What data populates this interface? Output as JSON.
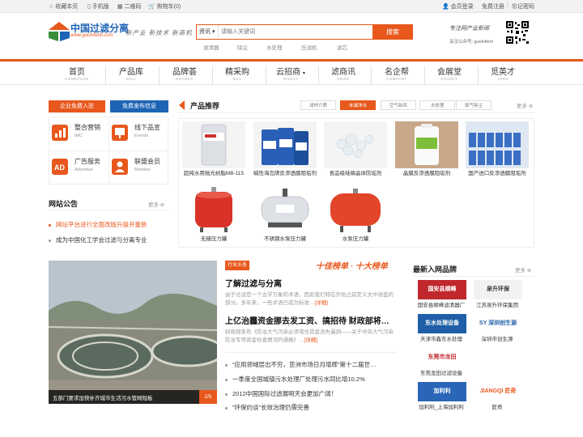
{
  "topbar": {
    "favorite": "收藏本页",
    "mobile": "手机版",
    "qrcode": "二维码",
    "cart": "购物车(0)",
    "login": "会员登录",
    "register": "免费注册",
    "forgot": "忘记密码"
  },
  "logo": {
    "cn": "中国过滤分离",
    "url": "www.guolvfenli.com",
    "slogan": "新产业 新技术 新商机"
  },
  "search": {
    "category": "资讯",
    "placeholder": "请输入关键词",
    "button": "搜索",
    "hot": [
      "滤清器",
      "除尘",
      "水处理",
      "压滤机",
      "滤芯"
    ]
  },
  "wechat": {
    "slogan": "专注网产业新闻",
    "follow": "关注公众号: guolvfenli"
  },
  "nav": [
    {
      "cn": "首页",
      "en": "HOMEPAGE"
    },
    {
      "cn": "产品库",
      "en": "SELL"
    },
    {
      "cn": "品牌荟",
      "en": "BRANDS"
    },
    {
      "cn": "精采购",
      "en": "BUY"
    },
    {
      "cn": "云招商",
      "en": "INVEST"
    },
    {
      "cn": "滤商讯",
      "en": "NEWS"
    },
    {
      "cn": "名企帮",
      "en": "COMPANY"
    },
    {
      "cn": "会展堂",
      "en": "EXHIBIT"
    },
    {
      "cn": "觅英才",
      "en": "JOBS"
    }
  ],
  "left": {
    "enter_btn": "企业免费入驻",
    "publish_btn": "免费发布信息",
    "services": [
      {
        "t1": "整合营销",
        "t2": "IMC",
        "icon": "chart-icon"
      },
      {
        "t1": "线下品宣",
        "t2": "Events",
        "icon": "board-icon"
      },
      {
        "t1": "广告服务",
        "t2": "Advertise",
        "icon": "ad-icon"
      },
      {
        "t1": "联盟会员",
        "t2": "Member",
        "icon": "member-icon"
      }
    ],
    "notice_title": "网站公告",
    "more": "更多",
    "notices": [
      {
        "text": "网站平台进行全面改版升级并重新",
        "color": "#e8581c"
      },
      {
        "text": "成为中国化工学会过滤与分离专业",
        "color": "#333333"
      }
    ]
  },
  "products": {
    "title": "产品推荐",
    "tabs": [
      "滤材介质",
      "末端净水",
      "空气新风",
      "水处理",
      "废气除尘"
    ],
    "active_tab": 1,
    "more": "更多",
    "items": [
      {
        "name": "超纯水用抛光树脂MB-115",
        "color": "#cfd4dc"
      },
      {
        "name": "碱性海岛牌反渗透膜阻垢剂",
        "color": "#2a5fb8"
      },
      {
        "name": "食品级硅磷晶体防垢剂",
        "color": "#e8eef2"
      },
      {
        "name": "晶膜反渗透膜阻垢剂",
        "color": "#7dbf3a"
      },
      {
        "name": "国产进口反渗透膜阻垢剂",
        "color": "#3a6fc4"
      },
      {
        "name": "无缝压力罐",
        "color": "#d93228"
      },
      {
        "name": "不锈钢水泵压力罐",
        "color": "#c8cdd2"
      },
      {
        "name": "水泵压力罐",
        "color": "#e2452a"
      }
    ]
  },
  "feature": {
    "caption": "五部门要求加快补齐城市生活污水管网短板",
    "page": "2/5",
    "badge": "行业头条",
    "banner": "十佳榜单 · 十大榜单",
    "headline1": "了解过滤与分离",
    "summary1": "由于过滤是一个古学万象的术语，因此我们特在开始之前定义文中涵盖的部分。多年来，一些术语已成为标准…",
    "detail": "[详细]",
    "headline2": "上亿治霾资金挪去发工资、搞招待 财政部将…",
    "summary2": "财政部发布《防治大气污染必须堵住资金流失漏洞——关于中央大气污染防治专项资金检查情况的通报》…",
    "news": [
      "“应用领域层出不穷，亚洲市场日月增辉”第十二届世…",
      "一季度全国城镇污水处理厂处理污水同比增10.2%",
      "2012中国国际过滤展明天会更加广阔！",
      "“环保约谈”长效治理仍需完善"
    ]
  },
  "brands": {
    "title": "最新入网品牌",
    "more": "更多",
    "items": [
      {
        "name": "国安县顺峰滤清器厂",
        "logo_text": "国安县顺峰",
        "color": "#c0282d",
        "text_color": "#ffffff"
      },
      {
        "name": "江苏泉升环保集团",
        "logo_text": "泉升环保",
        "color": "#f2f2f2",
        "text_color": "#333333"
      },
      {
        "name": "天津市鑫东水处理",
        "logo_text": "东水处理设备",
        "color": "#1e5fa8",
        "text_color": "#ffffff"
      },
      {
        "name": "深圳市创生源",
        "logo_text": "SY 深圳创生源",
        "color": "#ffffff",
        "text_color": "#1e5fa8"
      },
      {
        "name": "东莞龙田过滤设备",
        "logo_text": "东莞市龙田",
        "color": "#ffffff",
        "text_color": "#c0282d"
      },
      {
        "name": "",
        "logo_text": "",
        "color": "#ffffff",
        "text_color": "#333333"
      },
      {
        "name": "加利利_上海加利利",
        "logo_text": "加利利",
        "color": "#2a66b8",
        "text_color": "#ffffff"
      },
      {
        "name": "匠奇",
        "logo_text": "JIANGQI 匠奇",
        "color": "#ffffff",
        "text_color": "#e8581c"
      }
    ]
  },
  "colors": {
    "accent": "#e8581c",
    "blue_btn": "#1e64b4"
  }
}
